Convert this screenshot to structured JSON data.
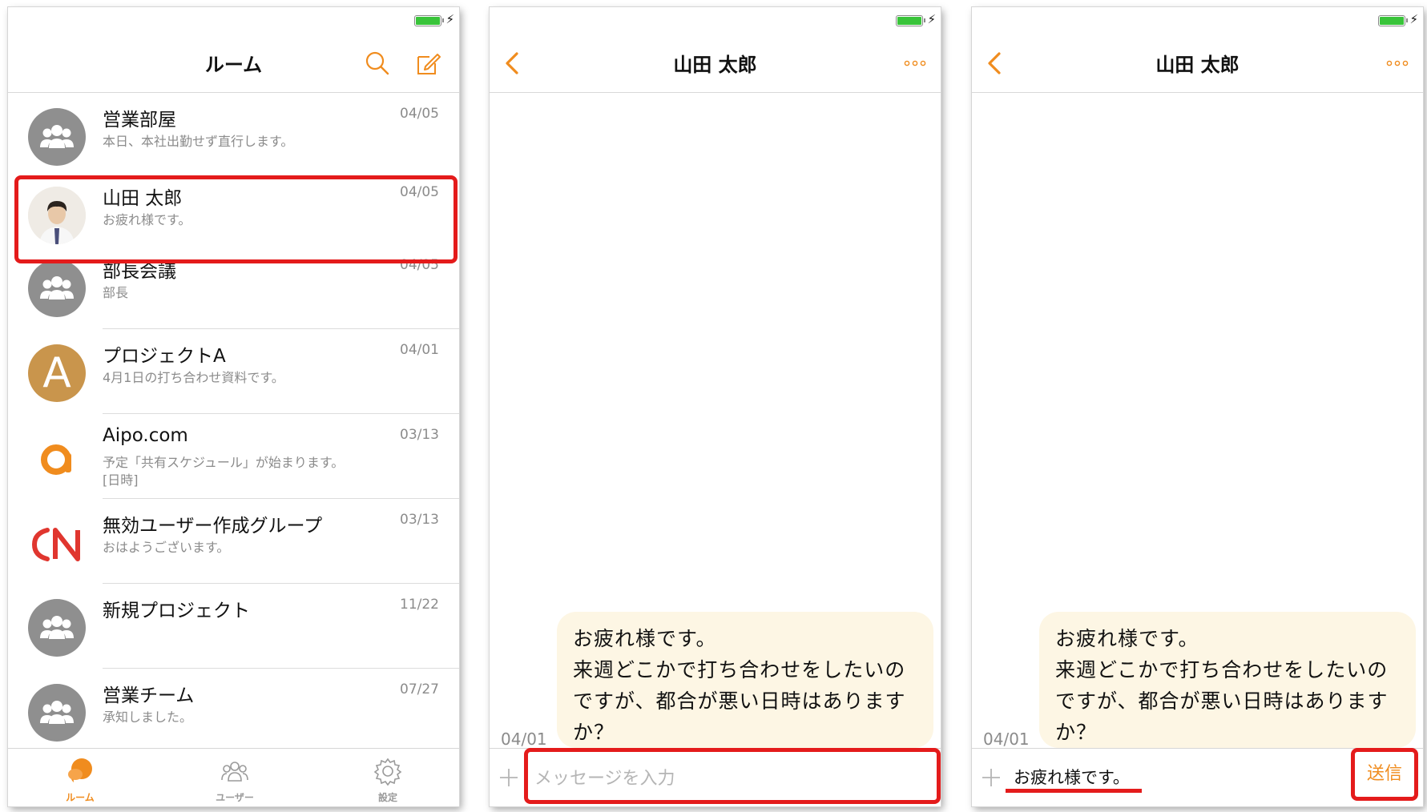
{
  "screen_list": {
    "title": "ルーム",
    "rooms": [
      {
        "name": "営業部屋",
        "preview": "本日、本社出勤せず直行します。",
        "date": "04/05",
        "avatar": "group-icon"
      },
      {
        "name": "山田 太郎",
        "preview": "お疲れ様です。",
        "date": "04/05",
        "avatar": "user-photo"
      },
      {
        "name": "部長会議",
        "preview": "部長",
        "date": "04/05",
        "avatar": "group-icon"
      },
      {
        "name": "プロジェクトA",
        "preview": "4月1日の打ち合わせ資料です。",
        "date": "04/01",
        "avatar": "letter",
        "avatar_letter": "A"
      },
      {
        "name": "Aipo.com",
        "preview": "予定「共有スケジュール」が始まります。\n[日時]",
        "date": "03/13",
        "avatar": "aipo-logo"
      },
      {
        "name": "無効ユーザー作成グループ",
        "preview": "おはようございます。",
        "date": "03/13",
        "avatar": "custom-logo"
      },
      {
        "name": "新規プロジェクト",
        "preview": "",
        "date": "11/22",
        "avatar": "group-icon"
      },
      {
        "name": "営業チーム",
        "preview": "承知しました。",
        "date": "07/27",
        "avatar": "group-icon"
      }
    ],
    "tabs": [
      {
        "label": "ルーム",
        "icon": "chat-bubble-icon",
        "active": true
      },
      {
        "label": "ユーザー",
        "icon": "users-icon",
        "active": false
      },
      {
        "label": "設定",
        "icon": "gear-icon",
        "active": false
      }
    ]
  },
  "screen_chat_empty": {
    "title": "山田 太郎",
    "message": "お疲れ様です。\n来週どこかで打ち合わせをしたいのですが、都合が悪い日時はありますか？",
    "message_lines": [
      "お疲れ様です。",
      "来週どこかで打ち合わせをしたいの",
      "ですが、都合が悪い日時はあります",
      "か？"
    ],
    "message_date": "04/01",
    "input_placeholder": "メッセージを入力"
  },
  "screen_chat_typed": {
    "title": "山田 太郎",
    "message_lines": [
      "お疲れ様です。",
      "来週どこかで打ち合わせをしたいの",
      "ですが、都合が悪い日時はあります",
      "か？"
    ],
    "message_date": "04/01",
    "input_value": "お疲れ様です。",
    "send_label": "送信"
  },
  "colors": {
    "accent": "#f08c1e",
    "highlight": "#e41b1b",
    "bubble": "#fdf6e4",
    "avatar_gray": "#8f8f8f",
    "avatar_letter_bg": "#c9954c"
  }
}
